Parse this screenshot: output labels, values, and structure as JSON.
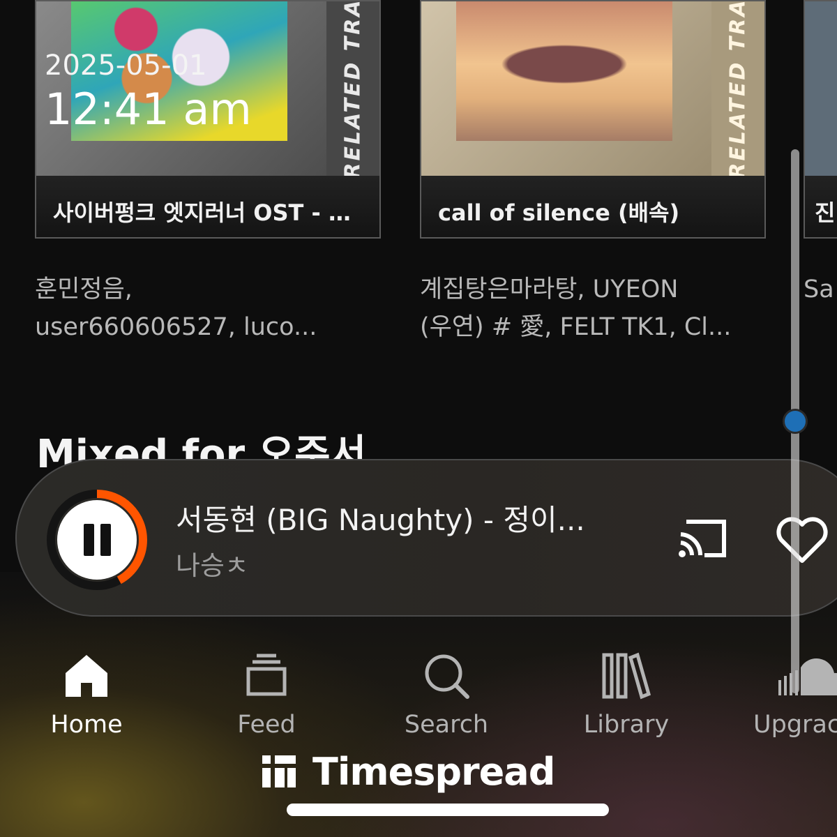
{
  "status": {
    "date": "2025-05-01",
    "time": "12:41 am"
  },
  "related_tracks": {
    "ribbon_label": "RELATED TRA",
    "cards": [
      {
        "title": "사이버펑크 엣지러너 OST - ...",
        "artists_line1": "훈민정음,",
        "artists_line2": "user660606527, luco..."
      },
      {
        "title": "call of silence (배속)",
        "artists_line1": "계집탕은마라탕, UYEON",
        "artists_line2": "(우연) # 愛, FELT TK1, Cl..."
      },
      {
        "title": "진",
        "artists_line1": "Sa",
        "artists_line2": ""
      }
    ]
  },
  "section": {
    "title": "Mixed for 오주서"
  },
  "mini_player": {
    "track_title": "서동현 (BIG Naughty) - 정이...",
    "artist": "나승ㅊ",
    "progress": 0.42,
    "icons": [
      "pause-icon",
      "cast-icon",
      "heart-icon"
    ],
    "accent_color": "#ff5500"
  },
  "nav": {
    "items": [
      {
        "label": "Home",
        "icon": "home-icon"
      },
      {
        "label": "Feed",
        "icon": "feed-icon"
      },
      {
        "label": "Search",
        "icon": "search-icon"
      },
      {
        "label": "Library",
        "icon": "library-icon"
      },
      {
        "label": "Upgrac",
        "icon": "soundcloud-icon"
      }
    ]
  },
  "watermark": {
    "text": "Timespread"
  }
}
